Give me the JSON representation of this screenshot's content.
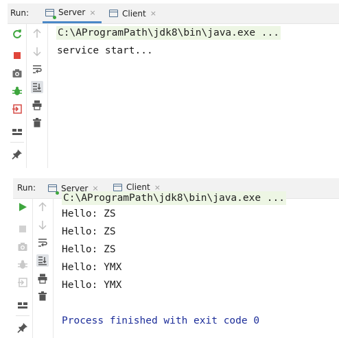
{
  "panel1": {
    "run_label": "Run:",
    "tabs": [
      {
        "label": "Server",
        "close": "×",
        "active": true
      },
      {
        "label": "Client",
        "close": "×",
        "active": false
      }
    ],
    "console_lines": [
      "C:\\AProgramPath\\jdk8\\bin\\java.exe ...",
      "service start..."
    ]
  },
  "panel2": {
    "run_label": "Run:",
    "tabs": [
      {
        "label": "Server",
        "close": "×",
        "active": false
      },
      {
        "label": "Client",
        "close": "×",
        "active": true
      }
    ],
    "console_lines": [
      "C:\\AProgramPath\\jdk8\\bin\\java.exe ...",
      "Hello: ZS",
      "Hello: ZS",
      "Hello: ZS",
      "Hello: YMX",
      "Hello: YMX",
      "",
      "Process finished with exit code 0"
    ]
  },
  "colors": {
    "command_line_bg": "#edf6e4",
    "exit_message": "#1c2d99",
    "run_green": "#3ea63e",
    "stop_red": "#e0453a",
    "active_tab_underline": "#4a88c7"
  }
}
